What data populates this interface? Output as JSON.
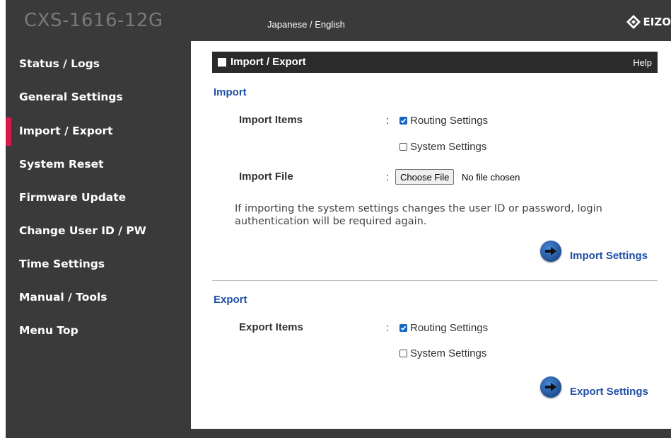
{
  "header": {
    "app_title": "CXS-1616-12G",
    "language_toggle": "Japanese / English",
    "logo_text": "EIZO"
  },
  "sidebar": {
    "items": [
      {
        "label": "Status / Logs",
        "active": false
      },
      {
        "label": "General Settings",
        "active": false
      },
      {
        "label": "Import / Export",
        "active": true
      },
      {
        "label": "System Reset",
        "active": false
      },
      {
        "label": "Firmware Update",
        "active": false
      },
      {
        "label": "Change User ID / PW",
        "active": false
      },
      {
        "label": "Time Settings",
        "active": false
      },
      {
        "label": "Manual / Tools",
        "active": false
      },
      {
        "label": "Menu Top",
        "active": false
      }
    ],
    "active_color": "#d8194b"
  },
  "section": {
    "title": "Import / Export",
    "help": "Help"
  },
  "import": {
    "heading": "Import",
    "items_label": "Import Items",
    "colon": ":",
    "routing": {
      "label": "Routing Settings",
      "checked": true
    },
    "system": {
      "label": "System Settings",
      "checked": false
    },
    "file_label": "Import File",
    "file_button": "Choose File",
    "file_status": "No file chosen",
    "note": "If importing the system settings changes the user ID or password, login authentication will be required again.",
    "action": "Import Settings"
  },
  "export": {
    "heading": "Export",
    "items_label": "Export Items",
    "colon": ":",
    "routing": {
      "label": "Routing Settings",
      "checked": true
    },
    "system": {
      "label": "System Settings",
      "checked": false
    },
    "action": "Export Settings"
  },
  "colors": {
    "sidebar_bg": "#3a3a3a",
    "link_blue": "#1f4fa8",
    "checkbox_blue": "#1565c0"
  }
}
